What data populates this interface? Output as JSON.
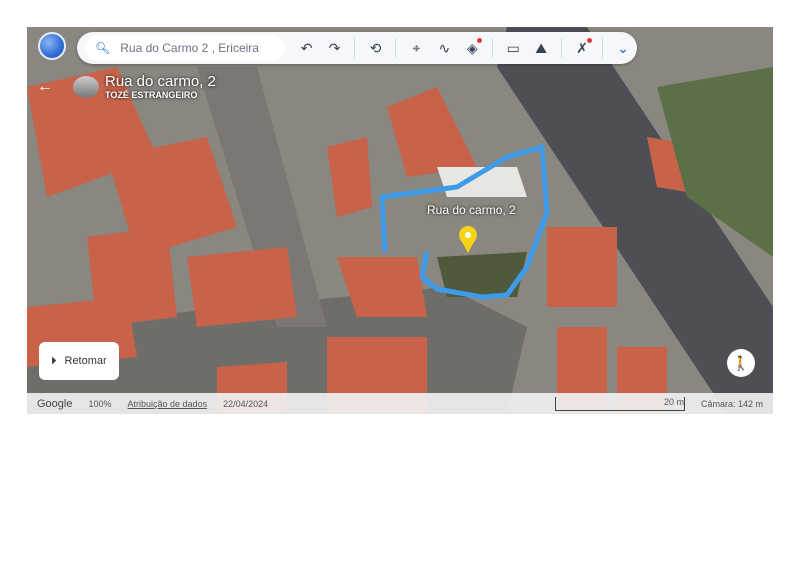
{
  "toolbar": {
    "search_placeholder": "Rua do Carmo 2 , Ericeira",
    "undo": "↶",
    "redo": "↷",
    "history": "⟲",
    "pin": "⌖",
    "path": "∿",
    "layers": "◈",
    "ruler": "▭",
    "terrain": "⛰",
    "tools": "✗",
    "more": "⌄"
  },
  "place": {
    "title": "Rua do carmo, 2",
    "subtitle": "TOZÉ ESTRANGEIRO",
    "back": "←"
  },
  "map": {
    "pin_label": "Rua do carmo, 2",
    "highlight_color": "#3d9be9",
    "pin_color": "#f6d314"
  },
  "retomar": {
    "icon": "⏵",
    "label": "Retomar"
  },
  "status": {
    "brand": "Google",
    "zoom": "100%",
    "attribution": "Atribuição de dados",
    "date": "22/04/2024",
    "scale": "20 m",
    "camera": "Câmara: 142 m"
  },
  "pegman": "🚶"
}
